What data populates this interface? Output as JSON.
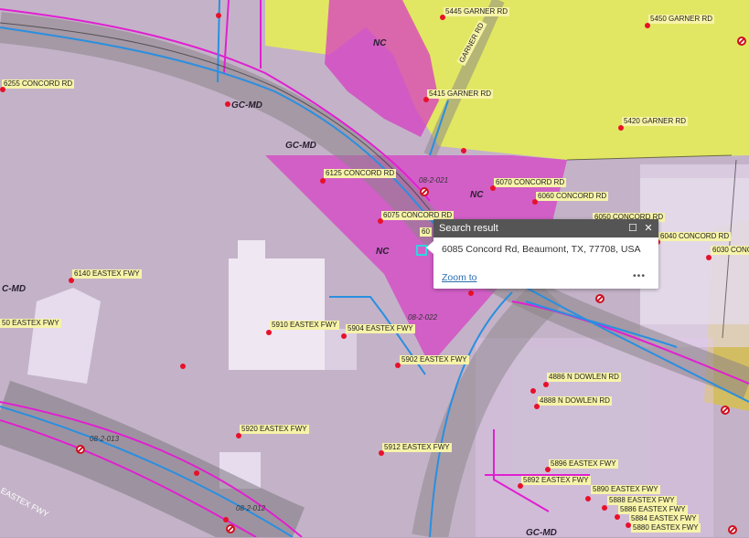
{
  "popup": {
    "title": "Search result",
    "address": "6085 Concord Rd, Beaumont, TX, 77708, USA",
    "zoom_label": "Zoom to",
    "more_label": "•••"
  },
  "zones": [
    "NC",
    "NC",
    "NC",
    "GC-MD",
    "GC-MD",
    "C-MD",
    "GC-MD"
  ],
  "parcels": [
    "08-2-021",
    "08-2-022",
    "08-2-013",
    "08-2-012"
  ],
  "addresses": [
    "5445 GARNER RD",
    "5450 GARNER RD",
    "6255 CONCORD RD",
    "5415 GARNER RD",
    "5420 GARNER RD",
    "6125 CONCORD RD",
    "6070 CONCORD RD",
    "6060 CONCORD RD",
    "6075 CONCORD RD",
    "6050 CONCORD RD",
    "6040 CONCORD RD",
    "6030 CONC",
    "6140 EASTEX FWY",
    "50 EASTEX FWY",
    "5910 EASTEX FWY",
    "5904 EASTEX FWY",
    "5902 EASTEX FWY",
    "4886 N DOWLEN RD",
    "4888 N DOWLEN RD",
    "5920 EASTEX FWY",
    "5912 EASTEX FWY",
    "5896 EASTEX FWY",
    "5892 EASTEX FWY",
    "5890 EASTEX FWY",
    "5888 EASTEX FWY",
    "5886 EASTEX FWY",
    "5884 EASTEX FWY",
    "5880 EASTEX FWY",
    "60"
  ],
  "roads": [
    "GARNER RD",
    "EASTEX FWY"
  ],
  "colors": {
    "commercial_zone": "#d73cc4",
    "residential_zone": "#e6f050",
    "parcel_line": "#e020d0",
    "water_line": "#2a8fe0",
    "address_dot": "#e8102a",
    "popup_header": "#555555",
    "link": "#2a6fb5"
  },
  "icons": [
    "hydrant-icon",
    "address-point-icon",
    "maximize-icon",
    "close-icon",
    "more-icon",
    "search-result-marker-icon"
  ]
}
